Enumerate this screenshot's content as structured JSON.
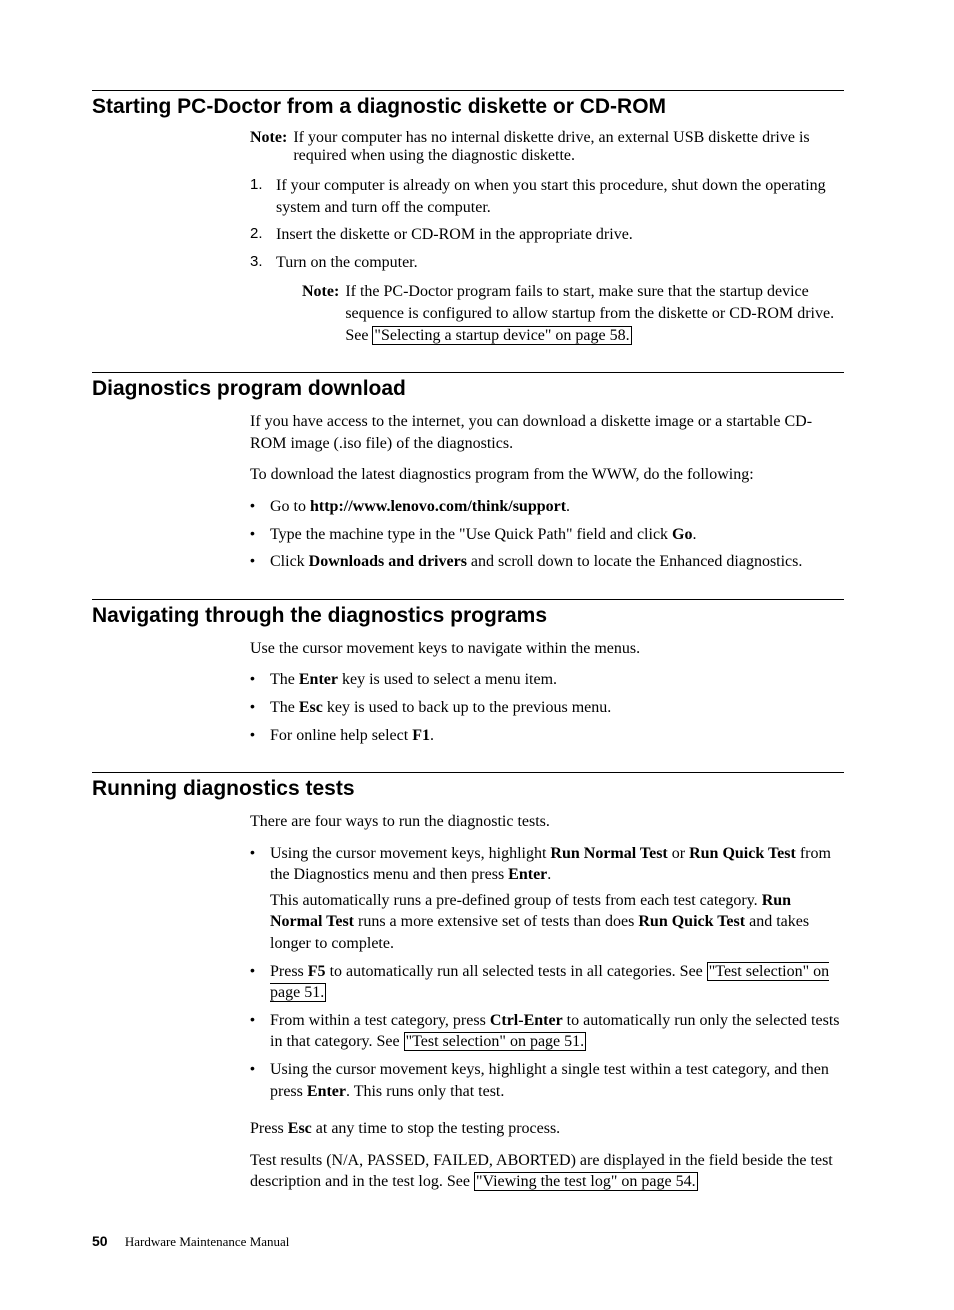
{
  "section1": {
    "heading": "Starting PC-Doctor from a diagnostic diskette or CD-ROM",
    "noteLabel": "Note:",
    "noteText": "If your computer has no internal diskette drive, an external USB diskette drive is required when using the diagnostic diskette.",
    "step1": "If your computer is already on when you start this procedure, shut down the operating system and turn off the computer.",
    "step2": "Insert the diskette or CD-ROM in the appropriate drive.",
    "step3": "Turn on the computer.",
    "note2Label": "Note:",
    "note2_a": "If the PC-Doctor program fails to start, make sure that the startup device sequence is configured to allow startup from the diskette or CD-ROM drive. See ",
    "note2_link": "\"Selecting a startup device\" on page 58."
  },
  "section2": {
    "heading": "Diagnostics program download",
    "p1": "If you have access to the internet, you can download a diskette image or a startable CD-ROM image (.iso file) of the diagnostics.",
    "p2": "To download the latest diagnostics program from the WWW, do the following:",
    "b1_a": "Go to ",
    "b1_b": "http://www.lenovo.com/think/support",
    "b1_c": ".",
    "b2_a": "Type the machine type in the \"Use Quick Path\" field and click ",
    "b2_b": "Go",
    "b2_c": ".",
    "b3_a": "Click ",
    "b3_b": "Downloads and drivers",
    "b3_c": " and scroll down to locate the Enhanced diagnostics."
  },
  "section3": {
    "heading": "Navigating through the diagnostics programs",
    "p1": "Use the cursor movement keys to navigate within the menus.",
    "b1_a": "The ",
    "b1_b": "Enter",
    "b1_c": " key is used to select a menu item.",
    "b2_a": "The ",
    "b2_b": "Esc",
    "b2_c": " key is used to back up to the previous menu.",
    "b3_a": "For online help select ",
    "b3_b": "F1",
    "b3_c": "."
  },
  "section4": {
    "heading": "Running diagnostics tests",
    "p1": "There are four ways to run the diagnostic tests.",
    "b1_a": "Using the cursor movement keys, highlight ",
    "b1_b": "Run Normal Test",
    "b1_c": " or ",
    "b1_d": "Run Quick Test",
    "b1_e": " from the Diagnostics menu and then press ",
    "b1_f": "Enter",
    "b1_g": ".",
    "b1_p2_a": "This automatically runs a pre-defined group of tests from each test category. ",
    "b1_p2_b": "Run Normal Test",
    "b1_p2_c": " runs a more extensive set of tests than does ",
    "b1_p2_d": "Run Quick Test",
    "b1_p2_e": " and takes longer to complete.",
    "b2_a": "Press ",
    "b2_b": "F5",
    "b2_c": " to automatically run all selected tests in all categories. See ",
    "b2_link": "\"Test selection\" on page 51.",
    "b3_a": "From within a test category, press ",
    "b3_b": "Ctrl-Enter",
    "b3_c": " to automatically run only the selected tests in that category. See ",
    "b3_link": "\"Test selection\" on page 51.",
    "b4_a": "Using the cursor movement keys, highlight a single test within a test category, and then press ",
    "b4_b": "Enter",
    "b4_c": ". This runs only that test.",
    "p2_a": "Press ",
    "p2_b": "Esc",
    "p2_c": " at any time to stop the testing process.",
    "p3_a": "Test results (N/A, PASSED, FAILED, ABORTED) are displayed in the field beside the test description and in the test log. See ",
    "p3_link": "\"Viewing the test log\" on page 54."
  },
  "footer": {
    "page": "50",
    "title": "Hardware Maintenance Manual"
  }
}
